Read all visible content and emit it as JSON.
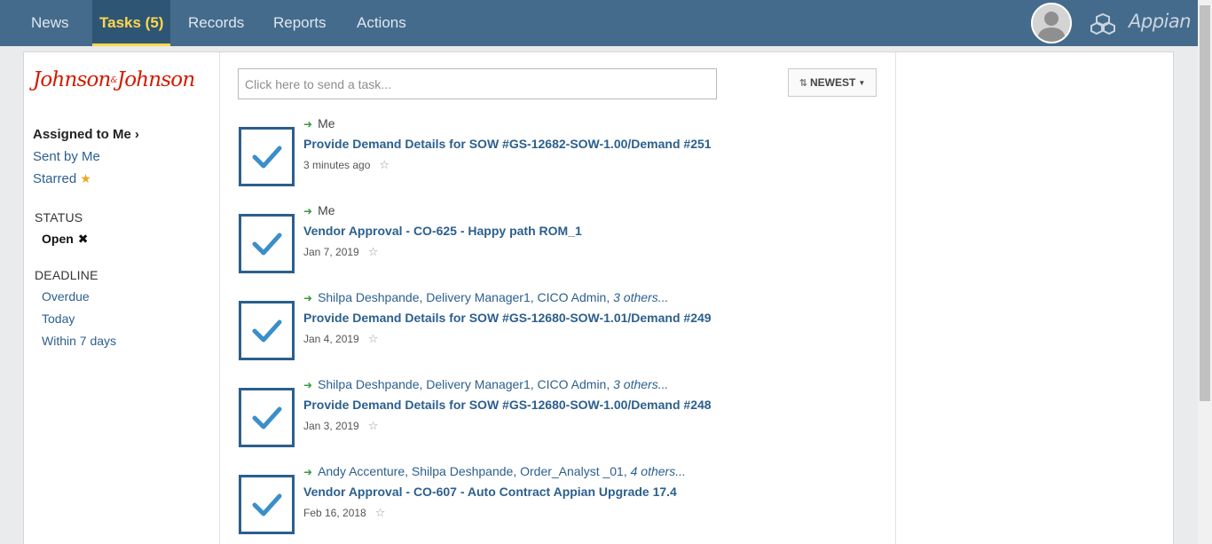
{
  "nav": {
    "tabs": [
      {
        "label": "News"
      },
      {
        "label": "Tasks (5)"
      },
      {
        "label": "Records"
      },
      {
        "label": "Reports"
      },
      {
        "label": "Actions"
      }
    ],
    "brand": "Appian",
    "active_tab": "Tasks (5)",
    "accent_color": "#ffd84a",
    "bar_color": "#456b8c"
  },
  "sidebar": {
    "logo_text": "Johnson&Johnson",
    "logo_left": "Johnson",
    "logo_amp": "&",
    "logo_right": "Johnson",
    "filters": {
      "assigned": "Assigned to Me",
      "sent": "Sent by Me",
      "starred": "Starred"
    },
    "status_heading": "STATUS",
    "status_value": "Open",
    "deadline_heading": "DEADLINE",
    "deadline_options": [
      "Overdue",
      "Today",
      "Within 7 days"
    ]
  },
  "main": {
    "task_placeholder": "Click here to send a task...",
    "sort_label": "NEWEST",
    "tasks": [
      {
        "people": "Me",
        "others": "",
        "title": "Provide Demand Details for SOW #GS-12682-SOW-1.00/Demand #251",
        "date": "3 minutes ago"
      },
      {
        "people": "Me",
        "others": "",
        "title": "Vendor Approval - CO-625 - Happy path ROM_1",
        "date": "Jan 7, 2019"
      },
      {
        "people": "Shilpa Deshpande, Delivery Manager1, CICO Admin,",
        "others": "3 others...",
        "title": "Provide Demand Details for SOW #GS-12680-SOW-1.01/Demand #249",
        "date": "Jan 4, 2019"
      },
      {
        "people": "Shilpa Deshpande, Delivery Manager1, CICO Admin,",
        "others": "3 others...",
        "title": "Provide Demand Details for SOW #GS-12680-SOW-1.00/Demand #248",
        "date": "Jan 3, 2019"
      },
      {
        "people": "Andy Accenture, Shilpa Deshpande, Order_Analyst _01,",
        "others": "4 others...",
        "title": "Vendor Approval - CO-607 - Auto Contract Appian Upgrade 17.4",
        "date": "Feb 16, 2018"
      }
    ]
  }
}
